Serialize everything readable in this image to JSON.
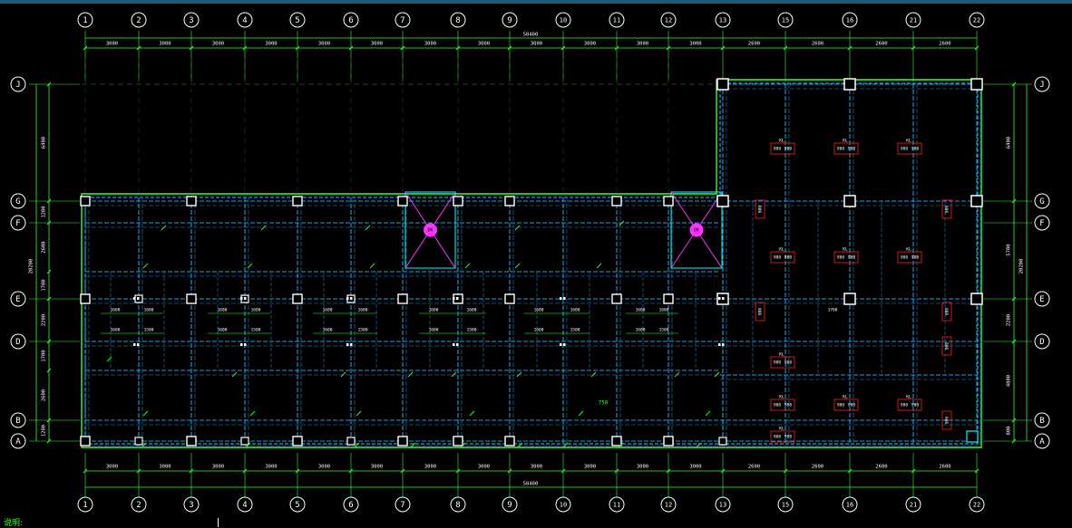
{
  "colors": {
    "background": "#000000",
    "topbar": "#1f5a7a",
    "axis_bubble": "#ffffff",
    "dimension": "#33ff33",
    "beam": "#1e9bd7",
    "beam_dash": "#1a5f8a",
    "slab": "#ffffff",
    "column": "#ffffff",
    "opening": "#ff33ff",
    "cyan": "#00ffff",
    "red": "#ff2020",
    "yellow": "#ffff00"
  },
  "axes": {
    "columns": [
      "1",
      "2",
      "3",
      "4",
      "5",
      "6",
      "7",
      "8",
      "9",
      "10",
      "11",
      "12",
      "13",
      "15",
      "16",
      "21",
      "22"
    ],
    "rows": [
      "J",
      "G",
      "F",
      "E",
      "D",
      "B",
      "A"
    ]
  },
  "dimensions": {
    "total_width": "50400",
    "top_spans": [
      "3000",
      "3000",
      "3000",
      "3000",
      "3000",
      "3000",
      "3000",
      "3000",
      "3000",
      "3000",
      "3000",
      "3000",
      "2600",
      "2600",
      "2600",
      "2600"
    ],
    "bottom_spans": [
      "3000",
      "3000",
      "3000",
      "3000",
      "3000",
      "3000",
      "3000",
      "3000",
      "3000",
      "3000",
      "3000",
      "3000",
      "2600",
      "2600",
      "2600",
      "2600"
    ],
    "left_spans": [
      "6400",
      "1200",
      "2600",
      "1700",
      "2200",
      "1700",
      "2600",
      "1200"
    ],
    "left_total": "20200",
    "right_spans": [
      "6400",
      "5700",
      "2200",
      "4800",
      "800"
    ],
    "right_total": "20200"
  },
  "labels": {
    "beam_mark": "KL",
    "opening_mark": "DK",
    "span_label_1600": "1600",
    "span_label_1500": "1500",
    "span_label_1700": "1700",
    "size_900": "900",
    "misc_750": "750"
  },
  "note": {
    "text": "说明:"
  }
}
